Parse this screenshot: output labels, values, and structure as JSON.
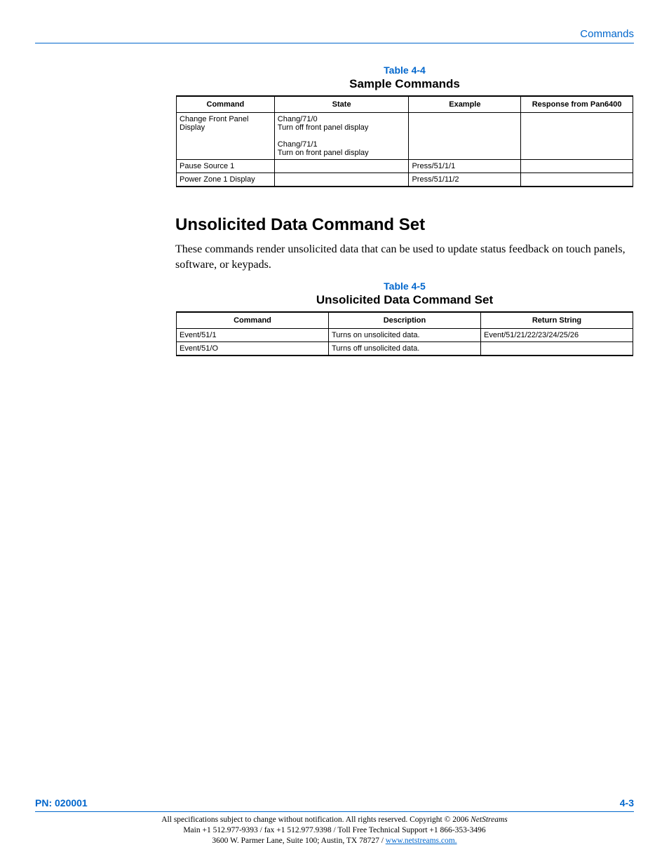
{
  "header": {
    "section": "Commands"
  },
  "table44": {
    "num": "Table 4-4",
    "title": "Sample Commands",
    "headers": [
      "Command",
      "State",
      "Example",
      "Response from Pan6400"
    ],
    "rows": [
      {
        "command": "Change Front Panel Display",
        "state": "Chang/71/0\nTurn off front panel display\n\nChang/71/1\nTurn on front panel display",
        "example": "",
        "response": ""
      },
      {
        "command": "Pause Source 1",
        "state": "",
        "example": "Press/51/1/1",
        "response": ""
      },
      {
        "command": "Power Zone 1 Display",
        "state": "",
        "example": "Press/51/11/2",
        "response": ""
      }
    ]
  },
  "section": {
    "heading": "Unsolicited Data Command Set",
    "body": "These commands render unsolicited data that can be used to update status feedback on touch panels, software, or keypads."
  },
  "table45": {
    "num": "Table 4-5",
    "title": "Unsolicited Data Command Set",
    "headers": [
      "Command",
      "Description",
      "Return String"
    ],
    "rows": [
      {
        "command": "Event/51/1",
        "description": "Turns on unsolicited data.",
        "retstr": "Event/51/21/22/23/24/25/26"
      },
      {
        "command": "Event/51/O",
        "description": "Turns off unsolicited data.",
        "retstr": ""
      }
    ]
  },
  "footer": {
    "pn": "PN: 020001",
    "page": "4-3",
    "line1a": "All specifications subject to change without notification.  All rights reserved.  Copyright © 2006 ",
    "line1b": "NetStreams",
    "line2": "Main +1 512.977-9393 / fax +1 512.977.9398 / Toll Free Technical Support +1 866-353-3496",
    "line3a": "3600 W. Parmer Lane, Suite 100; Austin, TX 78727 / ",
    "link": "www.netstreams.com."
  }
}
